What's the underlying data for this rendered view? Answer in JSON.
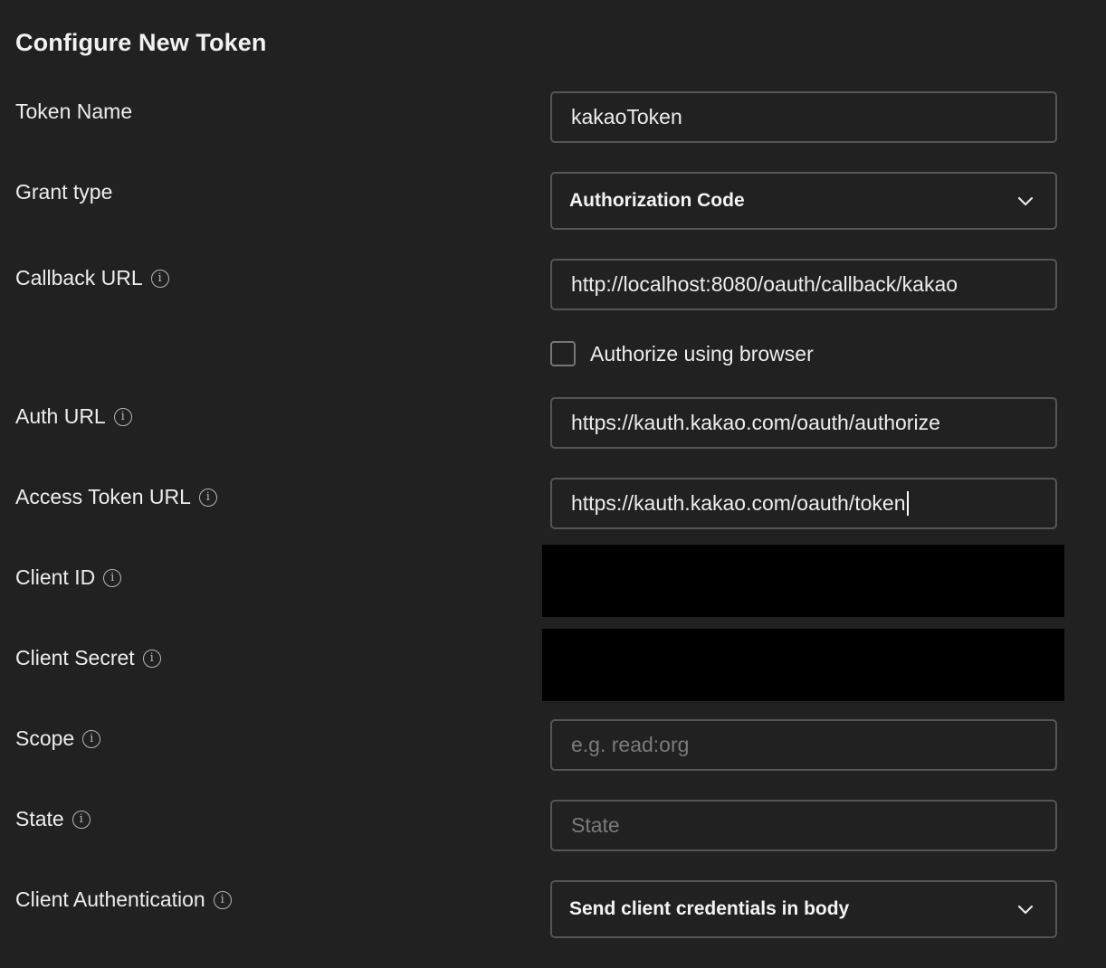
{
  "page": {
    "title": "Configure New Token"
  },
  "fields": {
    "token_name": {
      "label": "Token Name",
      "value": "kakaoToken"
    },
    "grant_type": {
      "label": "Grant type",
      "value": "Authorization Code"
    },
    "callback_url": {
      "label": "Callback URL",
      "value": "http://localhost:8080/oauth/callback/kakao"
    },
    "authorize_browser": {
      "label": "Authorize using browser",
      "checked": false
    },
    "auth_url": {
      "label": "Auth URL",
      "value": "https://kauth.kakao.com/oauth/authorize"
    },
    "access_token_url": {
      "label": "Access Token URL",
      "value": "https://kauth.kakao.com/oauth/token"
    },
    "client_id": {
      "label": "Client ID"
    },
    "client_secret": {
      "label": "Client Secret"
    },
    "scope": {
      "label": "Scope",
      "value": "",
      "placeholder": "e.g. read:org"
    },
    "state": {
      "label": "State",
      "value": "",
      "placeholder": "State"
    },
    "client_authentication": {
      "label": "Client Authentication",
      "value": "Send client credentials in body"
    }
  },
  "icons": {
    "info": "info-icon",
    "dropdown": "chevron-down-icon"
  },
  "colors": {
    "background": "#212121",
    "border": "#555555",
    "text": "#ededed",
    "placeholder": "#7b7b7b",
    "redaction": "#000000"
  }
}
